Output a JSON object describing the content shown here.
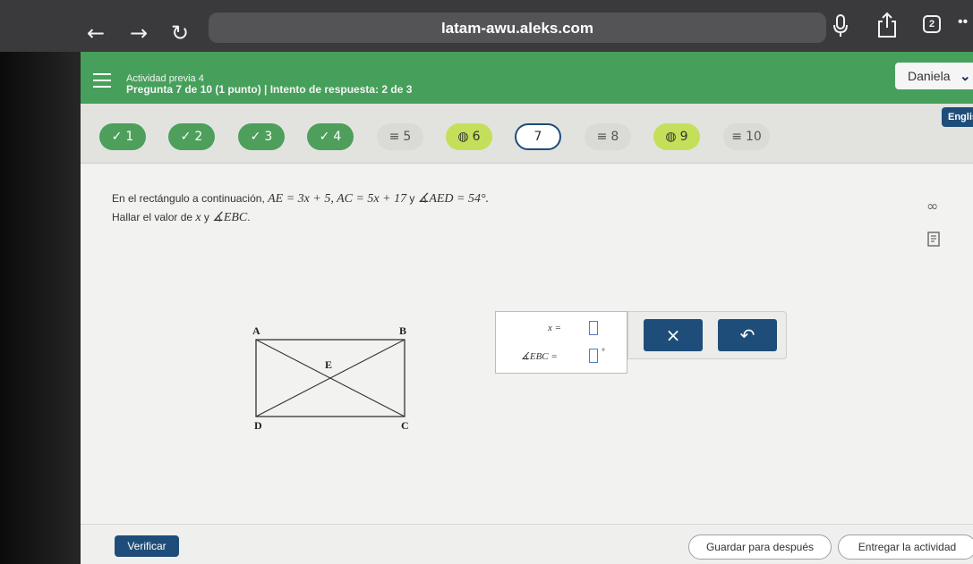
{
  "browser": {
    "back_icon": "←",
    "forward_icon": "→",
    "reload_icon": "↻",
    "url": "latam-awu.aleks.com",
    "tabs_count": "2",
    "more_icon": "••"
  },
  "header": {
    "activity_name": "Actividad previa 4",
    "question_info": "Pregunta 7 de 10 (1 punto)  |  Intento de respuesta: 2 de 3",
    "user_name": "Daniela",
    "user_chevron": "⌄",
    "language": "English"
  },
  "question_nav": [
    {
      "icon": "✓",
      "label": "1",
      "status": "done"
    },
    {
      "icon": "✓",
      "label": "2",
      "status": "done"
    },
    {
      "icon": "✓",
      "label": "3",
      "status": "done"
    },
    {
      "icon": "✓",
      "label": "4",
      "status": "done"
    },
    {
      "icon": "≡",
      "label": "5",
      "status": "blank"
    },
    {
      "icon": "◍",
      "label": "6",
      "status": "partial"
    },
    {
      "icon": "",
      "label": "7",
      "status": "current"
    },
    {
      "icon": "≡",
      "label": "8",
      "status": "blank"
    },
    {
      "icon": "◍",
      "label": "9",
      "status": "partial"
    },
    {
      "icon": "≡",
      "label": "10",
      "status": "blank"
    }
  ],
  "problem": {
    "line1_prefix": "En el rectángulo a continuación, ",
    "ae": "AE",
    "eq1": " = 3x + 5, ",
    "ac": "AC",
    "eq2": " = 5x + 17",
    "joiner": " y ",
    "aed": "∡AED",
    "eq3": " = 54°.",
    "line2_prefix": "Hallar el valor de ",
    "var_x": "x",
    "line2_joiner": " y ",
    "ebc": "∡EBC",
    "line2_suffix": "."
  },
  "figure": {
    "labels": {
      "a": "A",
      "b": "B",
      "c": "C",
      "d": "D",
      "e": "E"
    }
  },
  "answer": {
    "x_label": "x =",
    "angle_label": "∡EBC =",
    "degree_symbol": "°"
  },
  "tools": {
    "clear_icon": "×",
    "undo_icon": "↶"
  },
  "icons": {
    "infinity": "∞"
  },
  "footer": {
    "verify": "Verificar",
    "save_later": "Guardar para después",
    "submit": "Entregar la actividad"
  }
}
